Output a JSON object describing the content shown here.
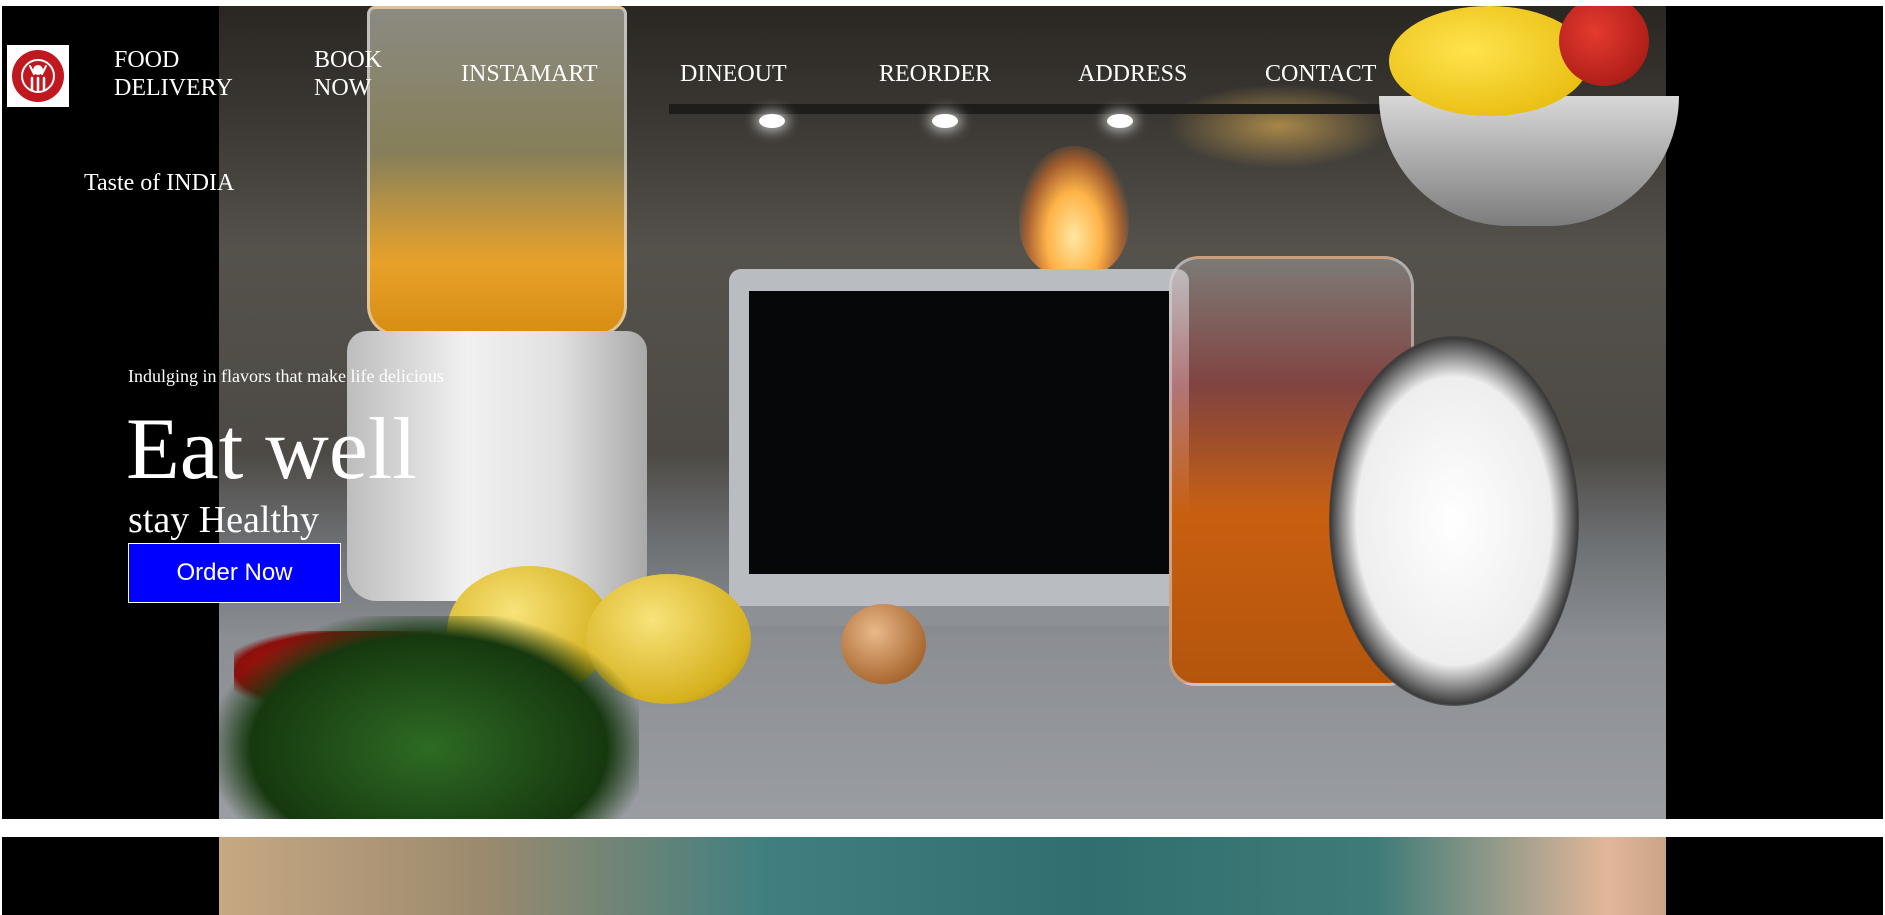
{
  "brand": {
    "logo_icon": "chef-utensils-logo-icon",
    "tagline": "Taste of INDIA",
    "accent_color": "#c0181e"
  },
  "nav": {
    "items": [
      {
        "label": "FOOD DELIVERY"
      },
      {
        "label": "BOOK NOW"
      },
      {
        "label": "INSTAMART"
      },
      {
        "label": "DINEOUT"
      },
      {
        "label": "REORDER"
      },
      {
        "label": "ADDRESS"
      },
      {
        "label": "CONTACT"
      }
    ]
  },
  "hero": {
    "kicker": "Indulging in flavors that make life delicious",
    "headline": "Eat well",
    "subhead": "stay Healthy",
    "cta_label": "Order Now",
    "cta_color": "#0000ff"
  }
}
